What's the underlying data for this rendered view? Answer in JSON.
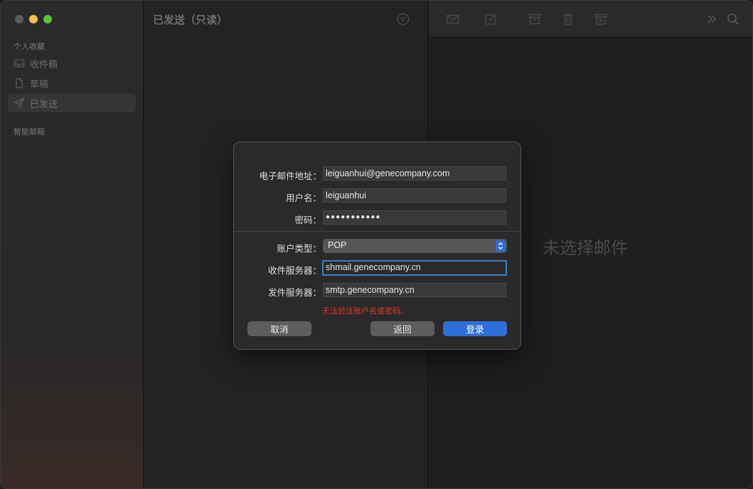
{
  "sidebar": {
    "favorites_label": "个人收藏",
    "items": [
      {
        "label": "收件箱",
        "icon": "inbox-icon"
      },
      {
        "label": "草稿",
        "icon": "document-icon"
      },
      {
        "label": "已发送",
        "icon": "paperplane-icon"
      }
    ],
    "smart_label": "智能邮箱"
  },
  "list": {
    "title": "已发送（只读）"
  },
  "content": {
    "empty_text": "未选择邮件",
    "toolbar_icons": [
      "envelope-icon",
      "compose-icon",
      "archive-icon",
      "trash-icon",
      "junk-icon",
      "more-icon",
      "search-icon"
    ]
  },
  "dialog": {
    "email_label": "电子邮件地址：",
    "email_value": "leiguanhui@genecompany.com",
    "username_label": "用户名：",
    "username_value": "leiguanhui",
    "password_label": "密码：",
    "password_value": "●●●●●●●●●●●",
    "account_type_label": "账户类型：",
    "account_type_value": "POP",
    "incoming_label": "收件服务器：",
    "incoming_value": "shmail.genecompany.cn",
    "outgoing_label": "发件服务器：",
    "outgoing_value": "smtp.genecompany.cn",
    "error": "无法验证账户名或密码。",
    "cancel": "取消",
    "back": "返回",
    "login": "登录"
  },
  "colors": {
    "accent": "#2f6fd9",
    "error": "#e03a2c"
  }
}
